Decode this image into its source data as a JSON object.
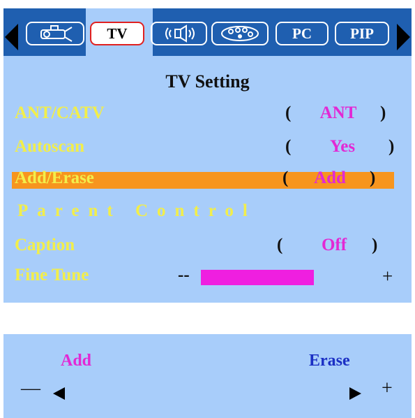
{
  "tabs": [
    {
      "id": "setup",
      "icon": "projector-icon",
      "label": ""
    },
    {
      "id": "tv",
      "icon": "",
      "label": "TV",
      "active": true
    },
    {
      "id": "audio",
      "icon": "speaker-icon",
      "label": ""
    },
    {
      "id": "picture",
      "icon": "palette-icon",
      "label": ""
    },
    {
      "id": "pc",
      "icon": "",
      "label": "PC"
    },
    {
      "id": "pip",
      "icon": "",
      "label": "PIP"
    }
  ],
  "panel": {
    "title": "TV  Setting",
    "rows": [
      {
        "label": "ANT/CATV",
        "value": "ANT"
      },
      {
        "label": "Autoscan",
        "value": "Yes"
      },
      {
        "label": "Add/Erase",
        "value": "Add",
        "selected": true
      },
      {
        "label": "Parent Control"
      },
      {
        "label": "Caption",
        "value": "Off"
      },
      {
        "label": "Fine Tune",
        "minus": "--",
        "plus": "+",
        "level": 0.6
      }
    ],
    "open_paren": "(",
    "close_paren": ")"
  },
  "bottom": {
    "left_option": "Add",
    "right_option": "Erase",
    "minus": "—",
    "plus": "+"
  },
  "colors": {
    "tabbar_bg": "#1f5fb0",
    "panel_bg": "#a8cdfa",
    "label_yellow": "#f2ee4a",
    "value_magenta": "#e229d4",
    "highlight_orange": "#f7951e",
    "bar_magenta": "#ef1fe0",
    "erase_blue": "#1b2fc4"
  }
}
